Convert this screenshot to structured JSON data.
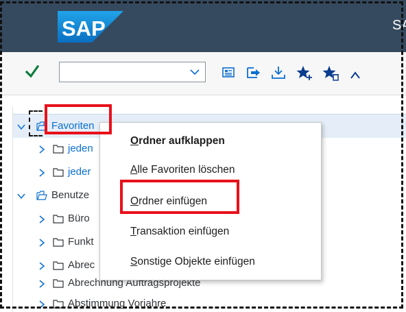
{
  "header": {
    "logo_text": "SAP",
    "title": "SA"
  },
  "toolbar": {
    "command_field": {
      "value": "",
      "placeholder": ""
    },
    "icons": [
      "check-icon",
      "dropdown-chevron-icon",
      "sap-easy-access-menu-icon",
      "other-menu-icon",
      "download-icon",
      "add-favorite-icon",
      "delete-favorite-icon",
      "move-favorite-icon"
    ]
  },
  "tree": {
    "rows": [
      {
        "label": "Favoriten",
        "expanded": true,
        "level": 0
      },
      {
        "label": "jeden",
        "expanded": false,
        "level": 1
      },
      {
        "label": "jeder",
        "expanded": false,
        "level": 1
      },
      {
        "label": "Benutze",
        "expanded": true,
        "level": 0
      },
      {
        "label": "Büro",
        "expanded": false,
        "level": 1
      },
      {
        "label": "Funkt",
        "expanded": false,
        "level": 1
      },
      {
        "label": "Abrec",
        "expanded": false,
        "level": 1
      },
      {
        "label": "Abrechnung Auftragsprojekte",
        "expanded": false,
        "level": 1
      },
      {
        "label": "Abstimmung Vorjahre",
        "expanded": false,
        "level": 1
      }
    ]
  },
  "context_menu": {
    "items": [
      {
        "mnemonic": "O",
        "rest": "rdner aufklappen",
        "bold": true
      },
      {
        "mnemonic": "A",
        "rest": "lle Favoriten löschen",
        "bold": false
      },
      {
        "mnemonic": "O",
        "rest": "rdner einfügen",
        "bold": false
      },
      {
        "mnemonic": "T",
        "rest": "ransaktion einfügen",
        "bold": false
      },
      {
        "mnemonic": "S",
        "rest": "onstige Objekte einfügen",
        "bold": false
      }
    ]
  },
  "colors": {
    "header_bg": "#354a5f",
    "logo_blue": "#1a8ad6",
    "highlight_red": "#e8101a",
    "selected_row_bg": "#e5eef8",
    "link_blue": "#0a6ed1",
    "check_green": "#107e3e"
  }
}
